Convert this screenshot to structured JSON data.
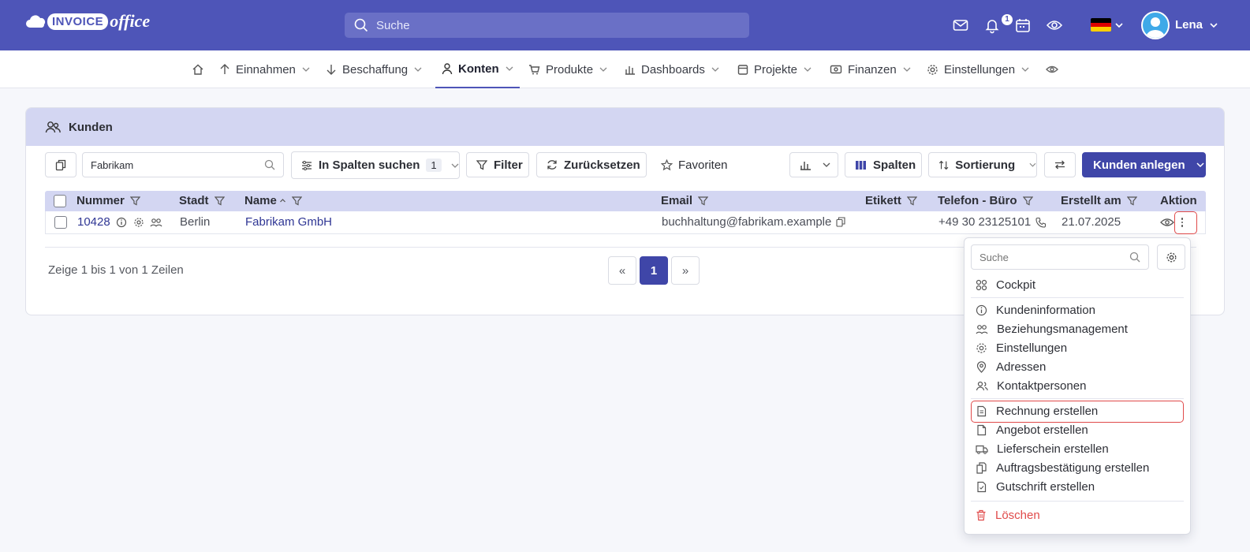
{
  "brand": {
    "word1": "INVOICE",
    "word2": "office"
  },
  "topbar": {
    "search_placeholder": "Suche",
    "notification_count": "1",
    "user_name": "Lena",
    "language_flag": "de",
    "colors": {
      "bar": "#4e55b8",
      "accent": "#3f46a8"
    }
  },
  "nav": {
    "items": [
      {
        "label": "Einnahmen",
        "icon": "arrow-up-icon"
      },
      {
        "label": "Beschaffung",
        "icon": "arrow-down-icon"
      },
      {
        "label": "Konten",
        "icon": "user-icon",
        "active": true
      },
      {
        "label": "Produkte",
        "icon": "cart-icon"
      },
      {
        "label": "Dashboards",
        "icon": "bar-chart-icon"
      },
      {
        "label": "Projekte",
        "icon": "calendar-icon"
      },
      {
        "label": "Finanzen",
        "icon": "money-icon"
      },
      {
        "label": "Einstellungen",
        "icon": "gear-icon"
      }
    ]
  },
  "card": {
    "title": "Kunden"
  },
  "toolbar": {
    "filter_value": "Fabrikam",
    "search_in_columns_label": "In Spalten suchen",
    "search_in_columns_count": "1",
    "filter_label": "Filter",
    "reset_label": "Zurücksetzen",
    "favorites_label": "Favoriten",
    "columns_label": "Spalten",
    "sort_label": "Sortierung",
    "create_label": "Kunden anlegen"
  },
  "table": {
    "headers": [
      "Nummer",
      "Stadt",
      "Name",
      "Email",
      "Etikett",
      "Telefon - Büro",
      "Erstellt am",
      "Aktion"
    ],
    "rows": [
      {
        "nummer": "10428",
        "stadt": "Berlin",
        "name": "Fabrikam GmbH",
        "email": "buchhaltung@fabrikam.example",
        "etikett": "",
        "telefon": "+49 30 23125101",
        "erstellt": "21.07.2025"
      }
    ]
  },
  "pagination": {
    "info": "Zeige 1 bis 1 von 1 Zeilen",
    "prev": "«",
    "current": "1",
    "next": "»"
  },
  "action_menu": {
    "search_placeholder": "Suche",
    "items": [
      {
        "label": "Cockpit",
        "icon": "grid-icon"
      },
      {
        "label": "Kundeninformation",
        "icon": "info-icon"
      },
      {
        "label": "Beziehungsmanagement",
        "icon": "users-icon"
      },
      {
        "label": "Einstellungen",
        "icon": "gear-icon"
      },
      {
        "label": "Adressen",
        "icon": "map-pin-icon"
      },
      {
        "label": "Kontaktpersonen",
        "icon": "contacts-icon"
      },
      {
        "label": "Rechnung erstellen",
        "icon": "invoice-icon",
        "highlighted": true
      },
      {
        "label": "Angebot erstellen",
        "icon": "document-icon"
      },
      {
        "label": "Lieferschein erstellen",
        "icon": "truck-icon"
      },
      {
        "label": "Auftragsbestätigung erstellen",
        "icon": "copy-document-icon"
      },
      {
        "label": "Gutschrift erstellen",
        "icon": "credit-note-icon"
      },
      {
        "label": "Löschen",
        "icon": "trash-icon",
        "danger": true
      }
    ]
  }
}
